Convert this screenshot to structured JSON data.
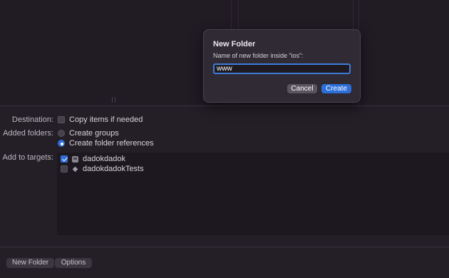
{
  "dialog": {
    "title": "New Folder",
    "prompt": "Name of new folder inside “ios”:",
    "input_value": "www",
    "cancel_label": "Cancel",
    "create_label": "Create"
  },
  "options": {
    "destination_label": "Destination:",
    "copy_items_label": "Copy items if needed",
    "copy_items_checked": false,
    "added_folders_label": "Added folders:",
    "create_groups_label": "Create groups",
    "create_folder_refs_label": "Create folder references",
    "selected_folder_option": "Create folder references",
    "add_to_targets_label": "Add to targets:",
    "targets": [
      {
        "name": "dadokdadok",
        "checked": true,
        "icon": "app-target-icon"
      },
      {
        "name": "dadokdadokTests",
        "checked": false,
        "icon": "test-target-icon"
      }
    ]
  },
  "footer": {
    "new_folder_label": "New Folder",
    "options_label": "Options"
  },
  "colors": {
    "accent": "#2d6fd8",
    "background": "#241e27"
  }
}
